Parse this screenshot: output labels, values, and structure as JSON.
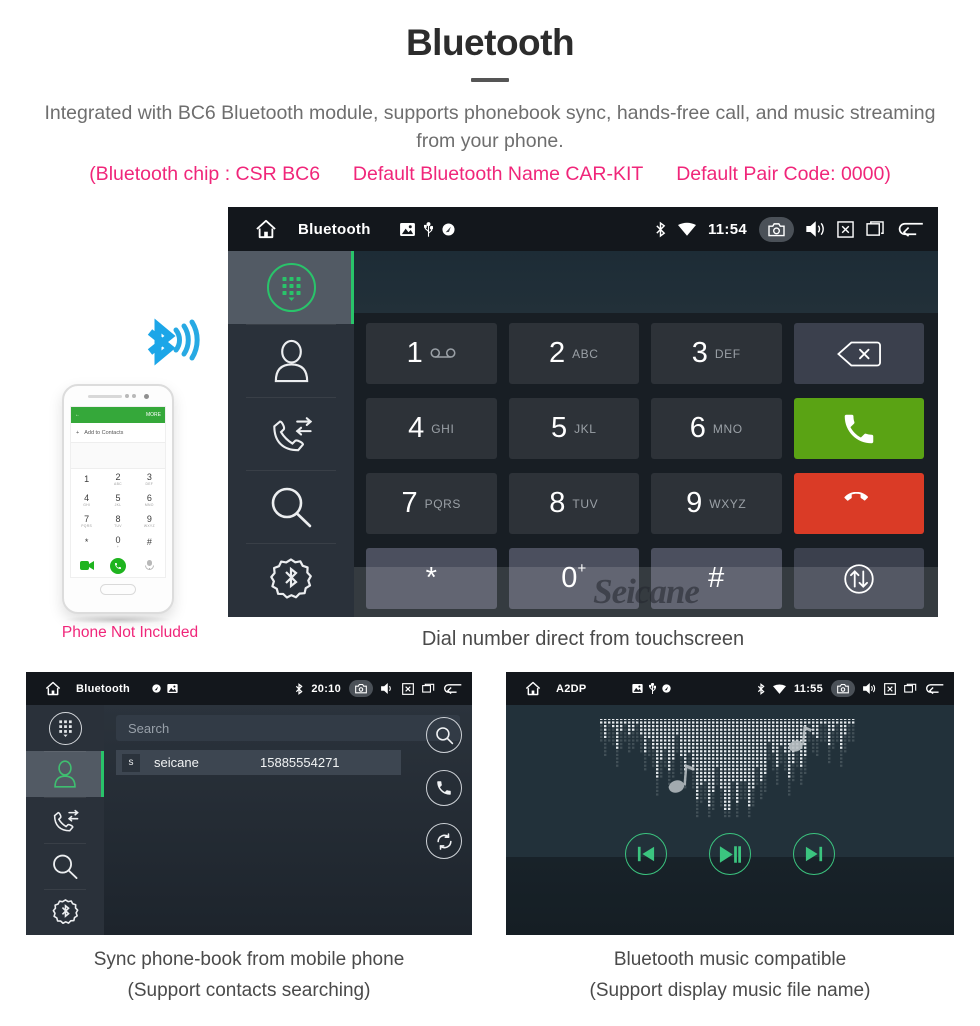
{
  "header": {
    "title": "Bluetooth",
    "subtitle": "Integrated with BC6 Bluetooth module, supports phonebook sync, hands-free call, and music streaming from your phone.",
    "spec_open": "(Bluetooth chip : CSR BC6",
    "spec_name": "Default Bluetooth Name CAR-KIT",
    "spec_code": "Default Pair Code: 0000)",
    "accent_pink": "#f0267a",
    "title_color": "#2c2c2c",
    "subtitle_color": "#6e6e6e"
  },
  "main_screen": {
    "statusbar": {
      "title": "Bluetooth",
      "clock": "11:54",
      "icons": [
        "home-icon",
        "gallery-icon",
        "usb-icon",
        "location-icon",
        "bluetooth-icon",
        "wifi-icon",
        "camera-icon",
        "volume-icon",
        "close-icon",
        "recents-icon",
        "back-icon"
      ]
    },
    "sidebar": [
      {
        "name": "dialpad",
        "label": "Dialpad",
        "active": true
      },
      {
        "name": "contacts",
        "label": "Contacts",
        "active": false
      },
      {
        "name": "call-history",
        "label": "Call History",
        "active": false
      },
      {
        "name": "search",
        "label": "Search",
        "active": false
      },
      {
        "name": "bluetooth-settings",
        "label": "Bluetooth Settings",
        "active": false
      }
    ],
    "number_field_value": "",
    "keys": [
      {
        "num": "1",
        "sub": "voicemail-icon",
        "type": "num"
      },
      {
        "num": "2",
        "sub": "ABC",
        "type": "num"
      },
      {
        "num": "3",
        "sub": "DEF",
        "type": "num"
      },
      {
        "num": "",
        "sub": "",
        "type": "backspace"
      },
      {
        "num": "4",
        "sub": "GHI",
        "type": "num"
      },
      {
        "num": "5",
        "sub": "JKL",
        "type": "num"
      },
      {
        "num": "6",
        "sub": "MNO",
        "type": "num"
      },
      {
        "num": "",
        "sub": "",
        "type": "call"
      },
      {
        "num": "7",
        "sub": "PQRS",
        "type": "num"
      },
      {
        "num": "8",
        "sub": "TUV",
        "type": "num"
      },
      {
        "num": "9",
        "sub": "WXYZ",
        "type": "num"
      },
      {
        "num": "",
        "sub": "",
        "type": "hangup"
      },
      {
        "num": "*",
        "sub": "",
        "type": "sym"
      },
      {
        "num": "0",
        "sub": "+",
        "type": "sym"
      },
      {
        "num": "#",
        "sub": "",
        "type": "sym"
      },
      {
        "num": "",
        "sub": "",
        "type": "transfer"
      }
    ],
    "watermark": "Seicane",
    "caption": "Dial number direct from touchscreen",
    "colors": {
      "call_green": "#5aa314",
      "hangup_red": "#da3b26",
      "active_green": "#29c46a"
    }
  },
  "phone_illustration": {
    "note": "Phone Not Included",
    "appbar_action": "MORE",
    "add_contacts": "Add to Contacts",
    "keys": [
      {
        "n": "1",
        "l": ""
      },
      {
        "n": "2",
        "l": "ABC"
      },
      {
        "n": "3",
        "l": "DEF"
      },
      {
        "n": "4",
        "l": "GHI"
      },
      {
        "n": "5",
        "l": "JKL"
      },
      {
        "n": "6",
        "l": "MNO"
      },
      {
        "n": "7",
        "l": "PQRS"
      },
      {
        "n": "8",
        "l": "TUV"
      },
      {
        "n": "9",
        "l": "WXYZ"
      },
      {
        "n": "*",
        "l": ""
      },
      {
        "n": "0",
        "l": "+"
      },
      {
        "n": "#",
        "l": ""
      }
    ]
  },
  "bottom_left": {
    "statusbar": {
      "title": "Bluetooth",
      "clock": "20:10"
    },
    "search_placeholder": "Search",
    "contact": {
      "initial": "s",
      "name": "seicane",
      "number": "15885554271"
    },
    "actions": [
      "search-icon",
      "call-icon",
      "sync-icon"
    ],
    "sidebar": [
      {
        "name": "dialpad",
        "active": false
      },
      {
        "name": "contacts",
        "active": true
      },
      {
        "name": "call-history",
        "active": false
      },
      {
        "name": "search",
        "active": false
      },
      {
        "name": "bluetooth-settings",
        "active": false
      }
    ],
    "caption_line1": "Sync phone-book from mobile phone",
    "caption_line2": "(Support contacts searching)"
  },
  "bottom_right": {
    "statusbar": {
      "title": "A2DP",
      "clock": "11:55"
    },
    "media_controls": [
      "previous-icon",
      "play-pause-icon",
      "next-icon"
    ],
    "caption_line1": "Bluetooth music compatible",
    "caption_line2": "(Support display music file name)"
  }
}
